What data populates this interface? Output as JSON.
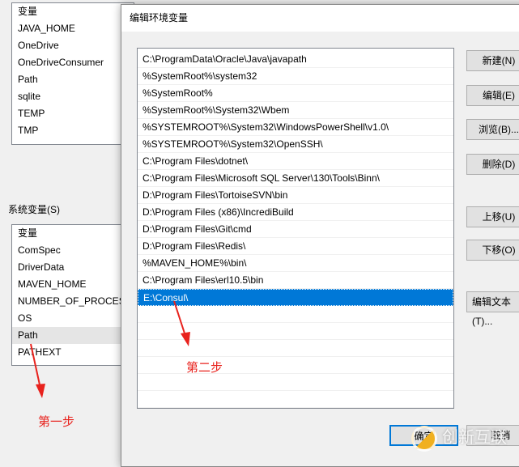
{
  "user_vars": {
    "header": "变量",
    "items": [
      "JAVA_HOME",
      "OneDrive",
      "OneDriveConsumer",
      "Path",
      "sqlite",
      "TEMP",
      "TMP"
    ]
  },
  "system_vars": {
    "group_label": "系统变量(S)",
    "header": "变量",
    "items": [
      "ComSpec",
      "DriverData",
      "MAVEN_HOME",
      "NUMBER_OF_PROCESSORS",
      "OS",
      "Path",
      "PATHEXT"
    ],
    "highlighted": "Path"
  },
  "dialog": {
    "title": "编辑环境变量",
    "paths": [
      "C:\\ProgramData\\Oracle\\Java\\javapath",
      "%SystemRoot%\\system32",
      "%SystemRoot%",
      "%SystemRoot%\\System32\\Wbem",
      "%SYSTEMROOT%\\System32\\WindowsPowerShell\\v1.0\\",
      "%SYSTEMROOT%\\System32\\OpenSSH\\",
      "C:\\Program Files\\dotnet\\",
      "C:\\Program Files\\Microsoft SQL Server\\130\\Tools\\Binn\\",
      "D:\\Program Files\\TortoiseSVN\\bin",
      "D:\\Program Files (x86)\\IncrediBuild",
      "D:\\Program Files\\Git\\cmd",
      "D:\\Program Files\\Redis\\",
      "%MAVEN_HOME%\\bin\\",
      "C:\\Program Files\\erl10.5\\bin",
      "E:\\Consul\\"
    ],
    "selected": "E:\\Consul\\",
    "buttons": {
      "new": "新建(N)",
      "edit": "编辑(E)",
      "browse": "浏览(B)...",
      "delete": "删除(D)",
      "up": "上移(U)",
      "down": "下移(O)",
      "edit_text": "编辑文本(T)...",
      "ok": "确定",
      "cancel": "取消"
    }
  },
  "annotations": {
    "step1": "第一步",
    "step2": "第二步",
    "color": "#e8221d"
  },
  "watermark": "创新互联"
}
